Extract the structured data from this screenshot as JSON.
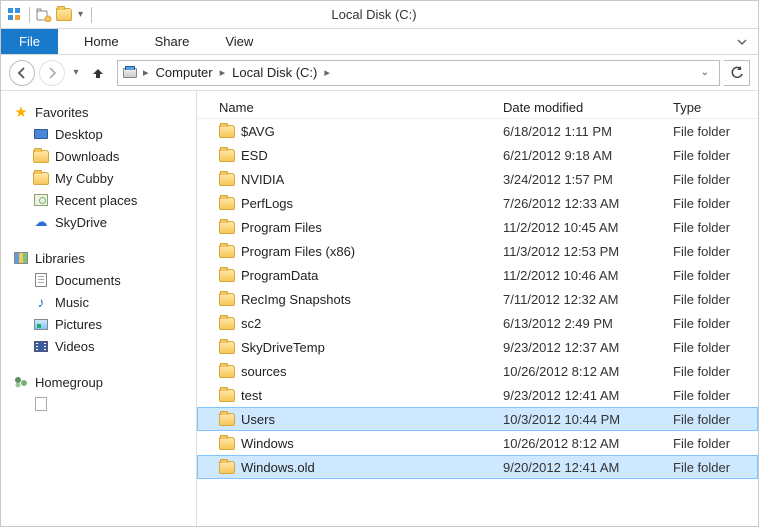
{
  "window": {
    "title": "Local Disk (C:)"
  },
  "ribbon": {
    "file": "File",
    "home": "Home",
    "share": "Share",
    "view": "View"
  },
  "breadcrumb": {
    "root_icon": "drive-icon",
    "items": [
      "Computer",
      "Local Disk (C:)"
    ]
  },
  "columns": {
    "name": "Name",
    "date": "Date modified",
    "type": "Type"
  },
  "nav": {
    "favorites": {
      "label": "Favorites",
      "items": [
        {
          "label": "Desktop",
          "icon": "monitor"
        },
        {
          "label": "Downloads",
          "icon": "folder"
        },
        {
          "label": "My Cubby",
          "icon": "folder"
        },
        {
          "label": "Recent places",
          "icon": "recent"
        },
        {
          "label": "SkyDrive",
          "icon": "cloud"
        }
      ]
    },
    "libraries": {
      "label": "Libraries",
      "items": [
        {
          "label": "Documents",
          "icon": "doc"
        },
        {
          "label": "Music",
          "icon": "music"
        },
        {
          "label": "Pictures",
          "icon": "pic"
        },
        {
          "label": "Videos",
          "icon": "vid"
        }
      ]
    },
    "homegroup": {
      "label": "Homegroup"
    }
  },
  "rows": [
    {
      "name": "$AVG",
      "date": "6/18/2012 1:11 PM",
      "type": "File folder",
      "selected": false
    },
    {
      "name": "ESD",
      "date": "6/21/2012 9:18 AM",
      "type": "File folder",
      "selected": false
    },
    {
      "name": "NVIDIA",
      "date": "3/24/2012 1:57 PM",
      "type": "File folder",
      "selected": false
    },
    {
      "name": "PerfLogs",
      "date": "7/26/2012 12:33 AM",
      "type": "File folder",
      "selected": false
    },
    {
      "name": "Program Files",
      "date": "11/2/2012 10:45 AM",
      "type": "File folder",
      "selected": false
    },
    {
      "name": "Program Files (x86)",
      "date": "11/3/2012 12:53 PM",
      "type": "File folder",
      "selected": false
    },
    {
      "name": "ProgramData",
      "date": "11/2/2012 10:46 AM",
      "type": "File folder",
      "selected": false
    },
    {
      "name": "RecImg Snapshots",
      "date": "7/11/2012 12:32 AM",
      "type": "File folder",
      "selected": false
    },
    {
      "name": "sc2",
      "date": "6/13/2012 2:49 PM",
      "type": "File folder",
      "selected": false
    },
    {
      "name": "SkyDriveTemp",
      "date": "9/23/2012 12:37 AM",
      "type": "File folder",
      "selected": false
    },
    {
      "name": "sources",
      "date": "10/26/2012 8:12 AM",
      "type": "File folder",
      "selected": false
    },
    {
      "name": "test",
      "date": "9/23/2012 12:41 AM",
      "type": "File folder",
      "selected": false
    },
    {
      "name": "Users",
      "date": "10/3/2012 10:44 PM",
      "type": "File folder",
      "selected": true
    },
    {
      "name": "Windows",
      "date": "10/26/2012 8:12 AM",
      "type": "File folder",
      "selected": false
    },
    {
      "name": "Windows.old",
      "date": "9/20/2012 12:41 AM",
      "type": "File folder",
      "selected": true
    }
  ]
}
